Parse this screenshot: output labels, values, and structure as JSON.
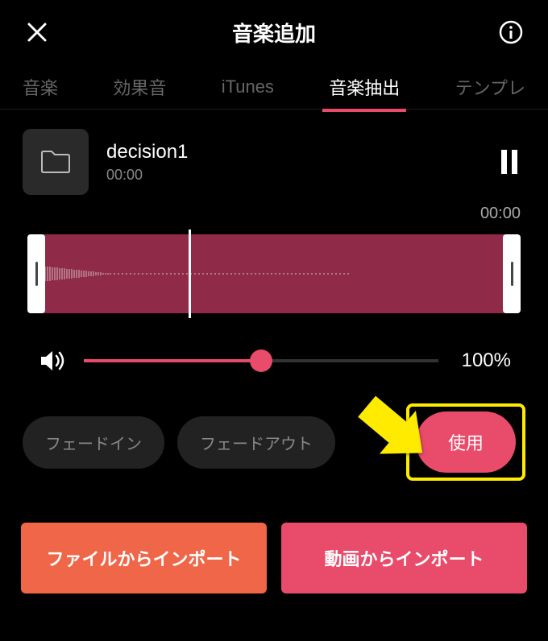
{
  "header": {
    "title": "音楽追加"
  },
  "tabs": [
    {
      "label": "音楽",
      "active": false
    },
    {
      "label": "効果音",
      "active": false
    },
    {
      "label": "iTunes",
      "active": false
    },
    {
      "label": "音楽抽出",
      "active": true
    },
    {
      "label": "テンプレ",
      "active": false
    }
  ],
  "track": {
    "name": "decision1",
    "duration": "00:00"
  },
  "playback": {
    "time": "00:00"
  },
  "volume": {
    "value_label": "100%",
    "percent": 50
  },
  "actions": {
    "fade_in": "フェードイン",
    "fade_out": "フェードアウト",
    "use": "使用"
  },
  "import": {
    "from_file": "ファイルからインポート",
    "from_video": "動画からインポート"
  }
}
